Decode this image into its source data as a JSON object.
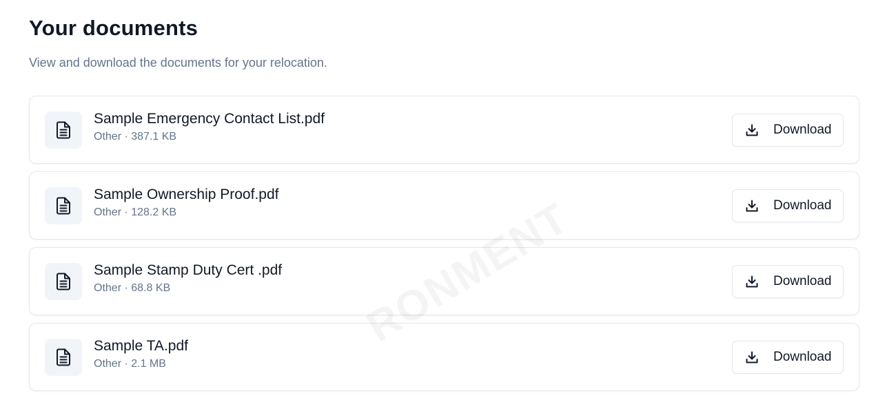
{
  "header": {
    "title": "Your documents",
    "subtitle": "View and download the documents for your relocation."
  },
  "documents": [
    {
      "name": "Sample Emergency Contact List.pdf",
      "meta": "Other · 387.1 KB",
      "action_label": "Download",
      "icon": "file-text-icon"
    },
    {
      "name": "Sample Ownership Proof.pdf",
      "meta": "Other · 128.2 KB",
      "action_label": "Download",
      "icon": "file-text-icon"
    },
    {
      "name": "Sample Stamp Duty Cert .pdf",
      "meta": "Other · 68.8 KB",
      "action_label": "Download",
      "icon": "file-text-icon"
    },
    {
      "name": "Sample TA.pdf",
      "meta": "Other · 2.1 MB",
      "action_label": "Download",
      "icon": "file-text-icon"
    }
  ],
  "watermark": "RONMENT",
  "colors": {
    "title": "#111827",
    "muted": "#64748b",
    "border": "#e5e7eb",
    "icon_bg": "#f1f5f9"
  }
}
